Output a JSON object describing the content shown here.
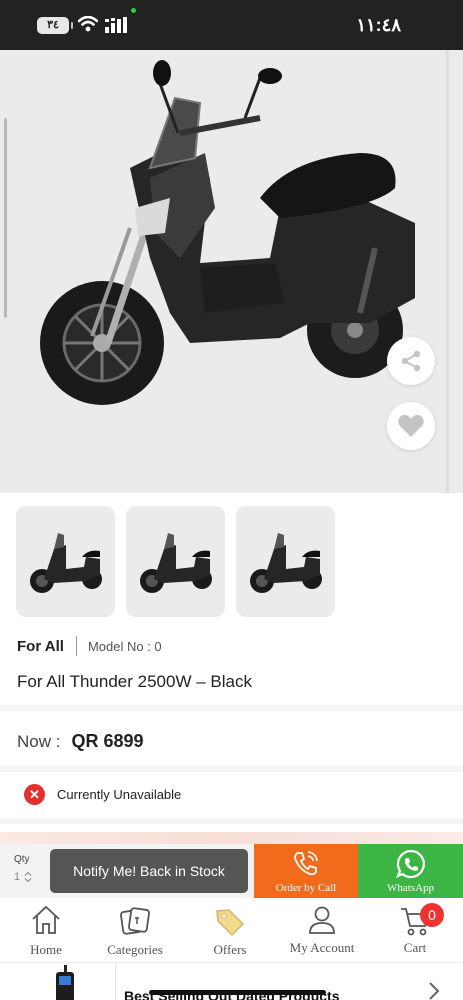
{
  "status_bar": {
    "time": "١١:٤٨",
    "battery": "٣٤",
    "icons": [
      "battery-icon",
      "wifi-icon",
      "signal-icon"
    ]
  },
  "product": {
    "image": "black-electric-scooter",
    "thumbnails": [
      "scooter-thumb-1",
      "scooter-thumb-2",
      "scooter-thumb-3"
    ],
    "brand": "For All",
    "model": "Model No : 0",
    "title": "For All Thunder 2500W – Black",
    "price_label": "Now :",
    "price": "QR 6899",
    "availability": "Currently Unavailable"
  },
  "actions": {
    "qty_label": "Qty",
    "qty_value": "1",
    "notify": "Notify Me! Back in Stock",
    "order_by_call": "Order by Call",
    "whatsapp": "WhatsApp"
  },
  "nav": {
    "items": [
      {
        "label": "Home",
        "icon": "home-icon"
      },
      {
        "label": "Categories",
        "icon": "categories-icon"
      },
      {
        "label": "Offers",
        "icon": "offers-tag-icon"
      },
      {
        "label": "My Account",
        "icon": "account-icon"
      },
      {
        "label": "Cart",
        "icon": "cart-icon"
      }
    ],
    "cart_count": "0"
  },
  "bottom_strip": {
    "title": "Best Selling Out Dated Products"
  },
  "colors": {
    "order_button": "#f26b1d",
    "whatsapp_button": "#3db544",
    "notify_button": "#555555",
    "unavailable": "#e0312f",
    "badge": "#ee3333"
  }
}
